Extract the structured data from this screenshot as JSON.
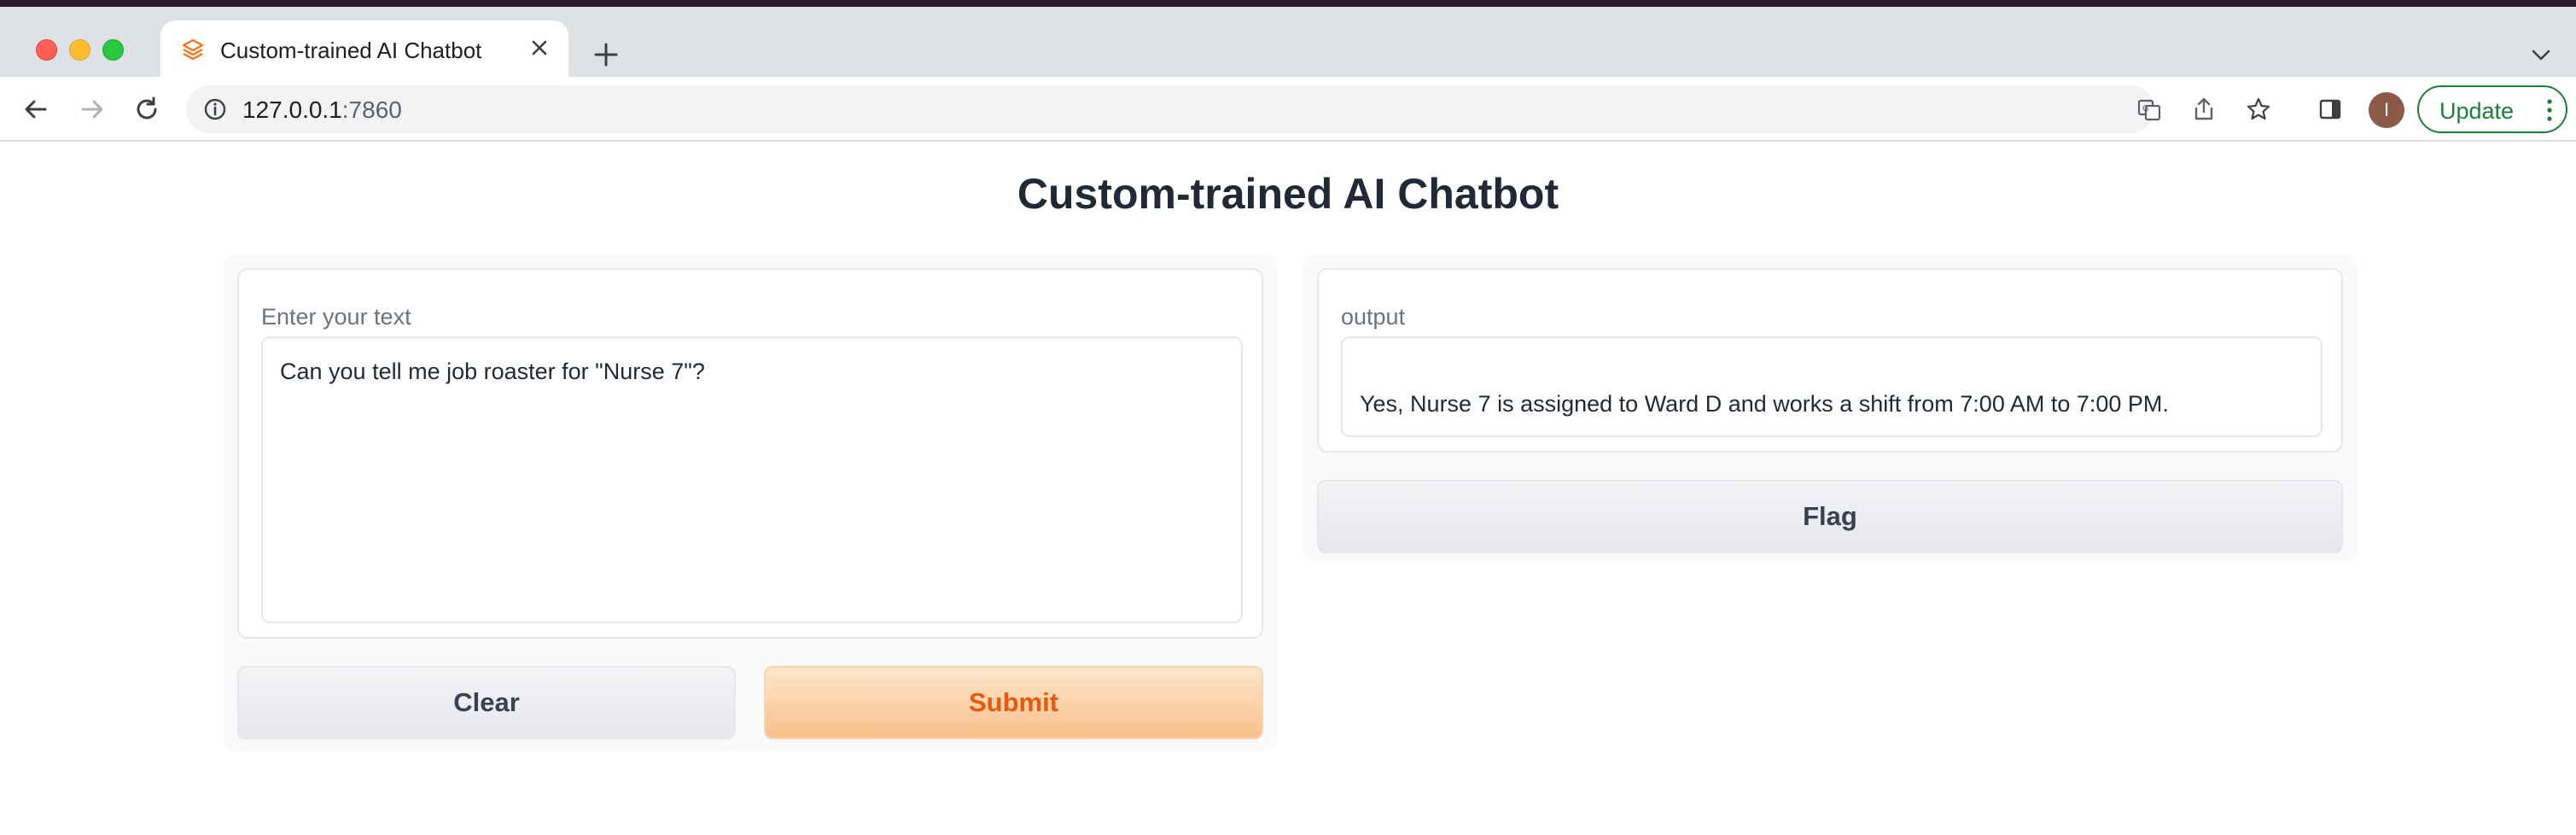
{
  "browser": {
    "tab_title": "Custom-trained AI Chatbot",
    "url_host": "127.0.0.1",
    "url_port": ":7860",
    "profile_initial": "I",
    "update_label": "Update"
  },
  "app": {
    "title": "Custom-trained AI Chatbot",
    "input": {
      "label": "Enter your text",
      "value": "Can you tell me job roaster for \"Nurse 7\"?"
    },
    "output": {
      "label": "output",
      "value": "Yes, Nurse 7 is assigned to Ward D and works a shift from 7:00 AM to 7:00 PM."
    },
    "buttons": {
      "clear": "Clear",
      "submit": "Submit",
      "flag": "Flag"
    }
  },
  "colors": {
    "accent": "#ea580c",
    "update_green": "#188038"
  },
  "icons": [
    "gradio-favicon-icon",
    "close-icon",
    "plus-icon",
    "chevron-down-icon",
    "back-icon",
    "forward-icon",
    "reload-icon",
    "info-icon",
    "translate-icon",
    "share-icon",
    "star-icon",
    "sidepanel-icon",
    "more-vertical-icon"
  ]
}
